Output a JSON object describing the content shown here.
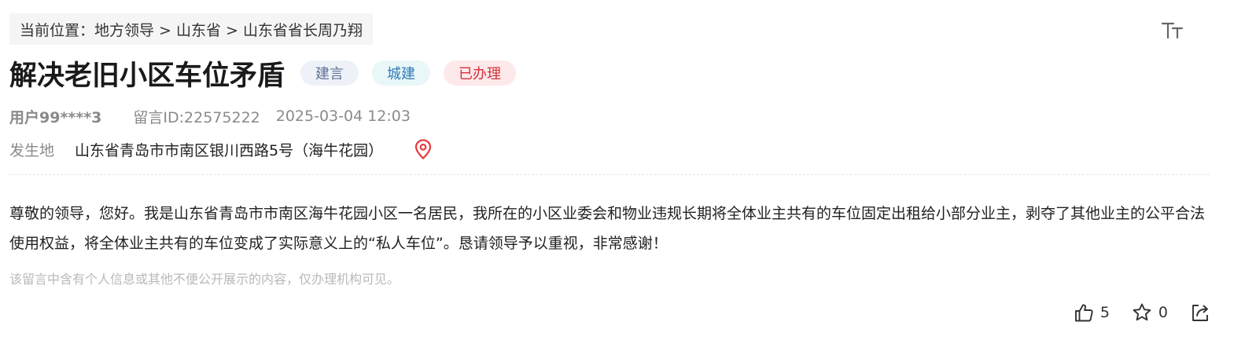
{
  "breadcrumb": {
    "text": "当前位置：地方领导 > 山东省 > 山东省省长周乃翔"
  },
  "header": {
    "title": "解决老旧小区车位矛盾",
    "tags": {
      "type": "建言",
      "category": "城建",
      "status": "已办理"
    }
  },
  "meta": {
    "user": "用户99****3",
    "message_id": "留言ID:22575222",
    "datetime": "2025-03-04 12:03"
  },
  "location": {
    "label": "发生地",
    "value": "山东省青岛市市南区银川西路5号（海牛花园）"
  },
  "content": {
    "body": "尊敬的领导，您好。我是山东省青岛市市南区海牛花园小区一名居民，我所在的小区业委会和物业违规长期将全体业主共有的车位固定出租给小部分业主，剥夺了其他业主的公平合法使用权益，将全体业主共有的车位变成了实际意义上的“私人车位”。恳请领导予以重视，非常感谢！",
    "privacy_notice": "该留言中含有个人信息或其他不便公开展示的内容，仅办理机构可见。"
  },
  "actions": {
    "like_count": "5",
    "favorite_count": "0"
  },
  "icons": {
    "font_size": "font-size-icon",
    "location": "location-pin-icon",
    "like": "thumbs-up-icon",
    "favorite": "star-icon",
    "share": "share-icon"
  },
  "colors": {
    "status_red": "#d63038",
    "category_blue": "#2f7bb8",
    "type_slate": "#5e7396",
    "pin_red": "#e8393f"
  }
}
